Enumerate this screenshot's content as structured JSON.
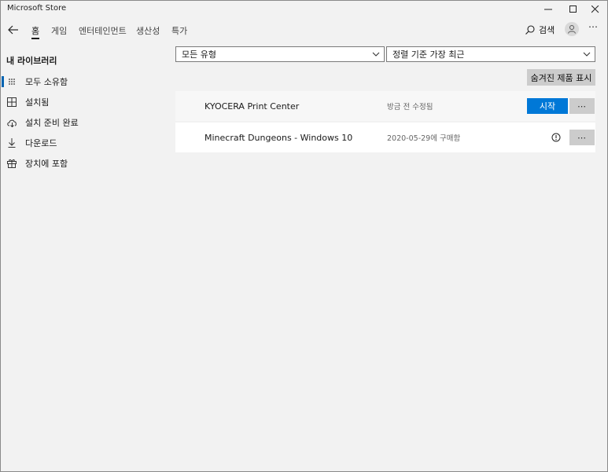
{
  "window": {
    "title": "Microsoft Store"
  },
  "nav": {
    "tabs": [
      {
        "label": "홈",
        "active": true
      },
      {
        "label": "게임",
        "active": false
      },
      {
        "label": "엔터테인먼트",
        "active": false
      },
      {
        "label": "생산성",
        "active": false
      },
      {
        "label": "특가",
        "active": false
      }
    ],
    "search_label": "검색",
    "more_label": "⋯"
  },
  "sidebar": {
    "title": "내 라이브러리",
    "items": [
      {
        "label": "모두 소유함",
        "icon": "grid-dots-icon",
        "active": true
      },
      {
        "label": "설치됨",
        "icon": "apps-installed-icon",
        "active": false
      },
      {
        "label": "설치 준비 완료",
        "icon": "cloud-download-icon",
        "active": false
      },
      {
        "label": "다운로드",
        "icon": "download-icon",
        "active": false
      },
      {
        "label": "장치에 포함",
        "icon": "gift-box-icon",
        "active": false
      }
    ]
  },
  "filters": {
    "type_value": "모든 유형",
    "sort_value": "정렬 기준 가장 최근",
    "show_hidden_label": "숨겨진 제품 표시"
  },
  "products": [
    {
      "name": "KYOCERA Print Center",
      "status": "방금 전 수정됨",
      "action_label": "시작",
      "more_label": "⋯"
    },
    {
      "name": "Minecraft Dungeons - Windows 10",
      "status": "2020-05-29에 구매함",
      "more_label": "⋯"
    }
  ],
  "colors": {
    "accent": "#0078d7",
    "background": "#f2f2f2"
  }
}
